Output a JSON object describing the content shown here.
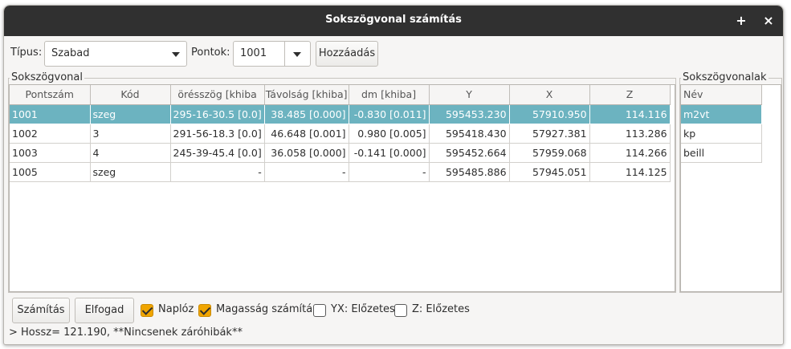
{
  "window": {
    "title": "Sokszögvonal számítás",
    "maximize": "+",
    "close": "×"
  },
  "toolbar": {
    "type_label": "Típus:",
    "type_value": "Szabad",
    "points_label": "Pontok:",
    "points_value": "1001",
    "add_button": "Hozzáadás"
  },
  "traverse": {
    "title": "Sokszögvonal",
    "columns": [
      "Pontszám",
      "Kód",
      "örésszög [khiba",
      "Távolság [khiba]",
      "dm [khiba]",
      "Y",
      "X",
      "Z"
    ],
    "rows": [
      [
        "1001",
        "szeg",
        "295-16-30.5 [0.0]",
        "38.485 [0.000]",
        "-0.830 [0.011]",
        "595453.230",
        "57910.950",
        "114.116"
      ],
      [
        "1002",
        "3",
        "291-56-18.3 [0.0]",
        "46.648 [0.001]",
        "0.980 [0.005]",
        "595418.430",
        "57927.381",
        "113.286"
      ],
      [
        "1003",
        "4",
        "245-39-45.4 [0.0]",
        "36.058 [0.000]",
        "-0.141 [0.000]",
        "595452.664",
        "57959.068",
        "114.266"
      ],
      [
        "1005",
        "szeg",
        "-",
        "-",
        "-",
        "595485.886",
        "57945.051",
        "114.125"
      ]
    ],
    "selected_row": 0
  },
  "traverses": {
    "title": "Sokszögvonalak",
    "column": "Név",
    "items": [
      "m2vt",
      "kp",
      "beill"
    ],
    "selected_item": 0
  },
  "bottom": {
    "calc_button": "Számítás",
    "accept_button": "Elfogad",
    "log_label": "Naplóz",
    "height_label": "Magasság számítás",
    "yx_label": "YX: Előzetes",
    "z_label": "Z: Előzetes",
    "checks": {
      "log": true,
      "height": true,
      "yx": false,
      "z": false
    }
  },
  "status": "> Hossz= 121.190, **Nincsenek záróhibák**",
  "colors": {
    "selection": "#6cb3c0",
    "titlebar": "#303030",
    "check_accent": "#f0a500"
  }
}
